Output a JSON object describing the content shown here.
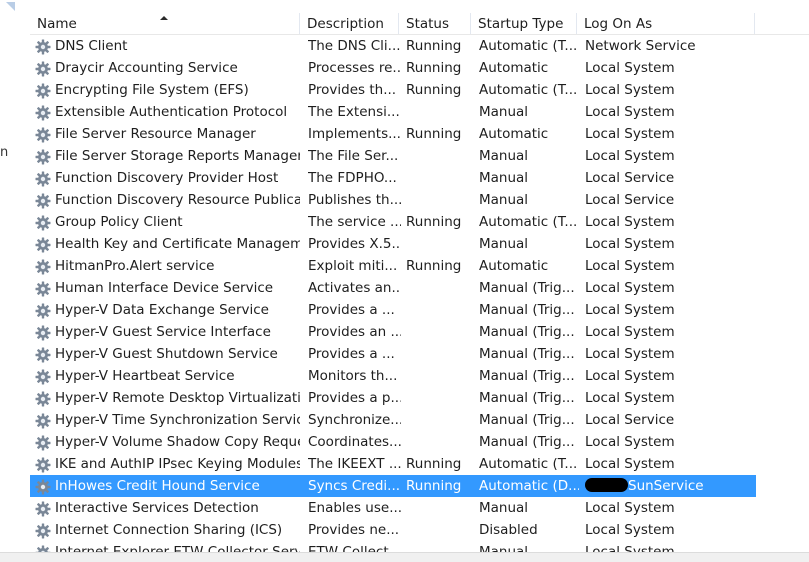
{
  "columns": {
    "name": "Name",
    "description": "Description",
    "status": "Status",
    "startup_type": "Startup Type",
    "log_on_as": "Log On As"
  },
  "left_pane": {
    "cut_letter": "n"
  },
  "selected_index": 20,
  "colors": {
    "selection": "#3399ff",
    "selection_text": "#ffffff",
    "gear": "#7a8797"
  },
  "icon": "gear-icon",
  "services": [
    {
      "name": "DNS Client",
      "description": "The DNS Cli...",
      "status": "Running",
      "startup_type": "Automatic (T...",
      "log_on_as": "Network Service"
    },
    {
      "name": "Draycir Accounting Service",
      "description": "Processes re...",
      "status": "Running",
      "startup_type": "Automatic",
      "log_on_as": "Local System"
    },
    {
      "name": "Encrypting File System (EFS)",
      "description": "Provides th...",
      "status": "Running",
      "startup_type": "Automatic (T...",
      "log_on_as": "Local System"
    },
    {
      "name": "Extensible Authentication Protocol",
      "description": "The Extensi...",
      "status": "",
      "startup_type": "Manual",
      "log_on_as": "Local System"
    },
    {
      "name": "File Server Resource Manager",
      "description": "Implements...",
      "status": "Running",
      "startup_type": "Automatic",
      "log_on_as": "Local System"
    },
    {
      "name": "File Server Storage Reports Manager",
      "description": "The File Ser...",
      "status": "",
      "startup_type": "Manual",
      "log_on_as": "Local System"
    },
    {
      "name": "Function Discovery Provider Host",
      "description": "The FDPHO...",
      "status": "",
      "startup_type": "Manual",
      "log_on_as": "Local Service"
    },
    {
      "name": "Function Discovery Resource Publicati...",
      "description": "Publishes th...",
      "status": "",
      "startup_type": "Manual",
      "log_on_as": "Local Service"
    },
    {
      "name": "Group Policy Client",
      "description": "The service ...",
      "status": "Running",
      "startup_type": "Automatic (T...",
      "log_on_as": "Local System"
    },
    {
      "name": "Health Key and Certificate Management",
      "description": "Provides X.5...",
      "status": "",
      "startup_type": "Manual",
      "log_on_as": "Local System"
    },
    {
      "name": "HitmanPro.Alert service",
      "description": "Exploit miti...",
      "status": "Running",
      "startup_type": "Automatic",
      "log_on_as": "Local System"
    },
    {
      "name": "Human Interface Device Service",
      "description": "Activates an...",
      "status": "",
      "startup_type": "Manual (Trig...",
      "log_on_as": "Local System"
    },
    {
      "name": "Hyper-V Data Exchange Service",
      "description": "Provides a ...",
      "status": "",
      "startup_type": "Manual (Trig...",
      "log_on_as": "Local System"
    },
    {
      "name": "Hyper-V Guest Service Interface",
      "description": "Provides an ...",
      "status": "",
      "startup_type": "Manual (Trig...",
      "log_on_as": "Local System"
    },
    {
      "name": "Hyper-V Guest Shutdown Service",
      "description": "Provides a ...",
      "status": "",
      "startup_type": "Manual (Trig...",
      "log_on_as": "Local System"
    },
    {
      "name": "Hyper-V Heartbeat Service",
      "description": "Monitors th...",
      "status": "",
      "startup_type": "Manual (Trig...",
      "log_on_as": "Local System"
    },
    {
      "name": "Hyper-V Remote Desktop Virtualizatio...",
      "description": "Provides a p...",
      "status": "",
      "startup_type": "Manual (Trig...",
      "log_on_as": "Local System"
    },
    {
      "name": "Hyper-V Time Synchronization Service",
      "description": "Synchronize...",
      "status": "",
      "startup_type": "Manual (Trig...",
      "log_on_as": "Local Service"
    },
    {
      "name": "Hyper-V Volume Shadow Copy Reque...",
      "description": "Coordinates...",
      "status": "",
      "startup_type": "Manual (Trig...",
      "log_on_as": "Local System"
    },
    {
      "name": "IKE and AuthIP IPsec Keying Modules",
      "description": "The IKEEXT ...",
      "status": "Running",
      "startup_type": "Automatic (T...",
      "log_on_as": "Local System"
    },
    {
      "name": "InHowes Credit Hound Service",
      "description": "Syncs Credi...",
      "status": "Running",
      "startup_type": "Automatic (D...",
      "log_on_as": "SunService",
      "log_on_redacted": true
    },
    {
      "name": "Interactive Services Detection",
      "description": "Enables use...",
      "status": "",
      "startup_type": "Manual",
      "log_on_as": "Local System"
    },
    {
      "name": "Internet Connection Sharing (ICS)",
      "description": "Provides ne...",
      "status": "",
      "startup_type": "Disabled",
      "log_on_as": "Local System"
    },
    {
      "name": "Internet Explorer ETW Collector Service",
      "description": "ETW Collect...",
      "status": "",
      "startup_type": "Manual",
      "log_on_as": "Local System"
    }
  ]
}
